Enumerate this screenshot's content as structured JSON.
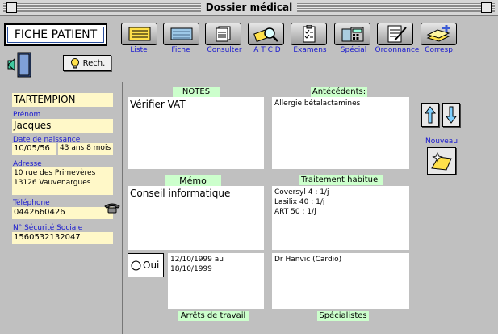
{
  "window": {
    "title": "Dossier médical"
  },
  "header": {
    "patient_sheet_label": "FICHE PATIENT",
    "search_label": "Rech."
  },
  "toolbar": {
    "items": [
      {
        "label": "Liste",
        "icon": "list-book-icon"
      },
      {
        "label": "Fiche",
        "icon": "card-icon"
      },
      {
        "label": "Consulter",
        "icon": "documents-icon"
      },
      {
        "label": "A T C D",
        "icon": "magnifier-icon"
      },
      {
        "label": "Examens",
        "icon": "clipboard-icon"
      },
      {
        "label": "Spécial",
        "icon": "calculator-icon"
      },
      {
        "label": "Ordonnance",
        "icon": "prescription-icon"
      },
      {
        "label": "Corresp.",
        "icon": "stack-plus-icon"
      }
    ]
  },
  "patient": {
    "name": "TARTEMPION",
    "first_name_label": "Prénom",
    "first_name": "Jacques",
    "birth_label": "Date de naissance",
    "birth_date": "10/05/56",
    "age": "43 ans 8 mois",
    "address_label": "Adresse",
    "address_line1": "10 rue des Primevères",
    "address_line2": "13126 Vauvenargues",
    "phone_label": "Téléphone",
    "phone": "0442660426",
    "ss_label": "N° Sécurité Sociale",
    "ss_number": "1560532132047"
  },
  "notes": {
    "title": "NOTES",
    "text": "Vérifier VAT"
  },
  "antecedents": {
    "title": "Antécédents:",
    "text": "Allergie bétalactamines"
  },
  "memo": {
    "title": "Mémo",
    "text": "Conseil informatique"
  },
  "treatment": {
    "title": "Traitement habituel",
    "lines": [
      "Coversyl 4 : 1/j",
      "Lasilix 40 : 1/j",
      "ART 50 : 1/j"
    ]
  },
  "work_stop": {
    "title": "Arrêts de travail",
    "checkbox_label": "Oui",
    "text": "12/10/1999 au 18/10/1999"
  },
  "specialists": {
    "title": "Spécialistes",
    "text": "Dr Hanvic (Cardio)"
  },
  "new_label": "Nouveau"
}
